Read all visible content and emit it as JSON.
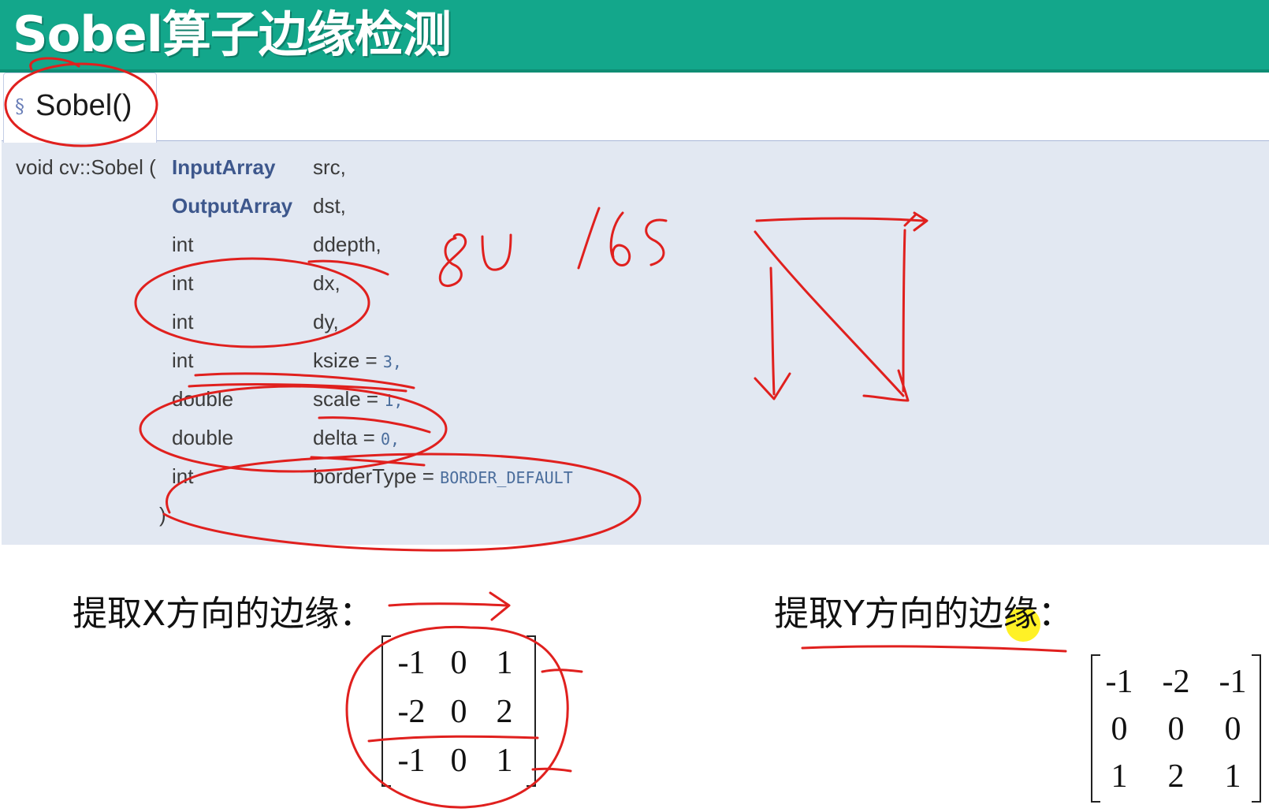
{
  "slide": {
    "title": "Sobel算子边缘检测",
    "accent_color": "#13a78b"
  },
  "tab": {
    "section_symbol": "§",
    "label": "Sobel()"
  },
  "declaration": {
    "prefix": "void cv::Sobel (",
    "params": [
      {
        "type": "InputArray",
        "name": "src,",
        "default": ""
      },
      {
        "type": "OutputArray",
        "name": "dst,",
        "default": ""
      },
      {
        "type": "int",
        "name": "ddepth,",
        "default": ""
      },
      {
        "type": "int",
        "name": "dx,",
        "default": ""
      },
      {
        "type": "int",
        "name": "dy,",
        "default": ""
      },
      {
        "type": "int",
        "name": "ksize = ",
        "default": "3,"
      },
      {
        "type": "double",
        "name": "scale = ",
        "default": "1,"
      },
      {
        "type": "double",
        "name": "delta = ",
        "default": "0,"
      },
      {
        "type": "int",
        "name": "borderType = ",
        "default": "BORDER_DEFAULT"
      }
    ],
    "closing": ")"
  },
  "annotations": {
    "note_8u": "8U",
    "note_16s": "16S"
  },
  "x_kernel": {
    "label": "提取X方向的边缘：",
    "rows": [
      [
        "-1",
        "0",
        "1"
      ],
      [
        "-2",
        "0",
        "2"
      ],
      [
        "-1",
        "0",
        "1"
      ]
    ]
  },
  "y_kernel": {
    "label": "提取Y方向的边缘：",
    "rows": [
      [
        "-1",
        "-2",
        "-1"
      ],
      [
        "0",
        "0",
        "0"
      ],
      [
        "1",
        "2",
        "1"
      ]
    ]
  }
}
